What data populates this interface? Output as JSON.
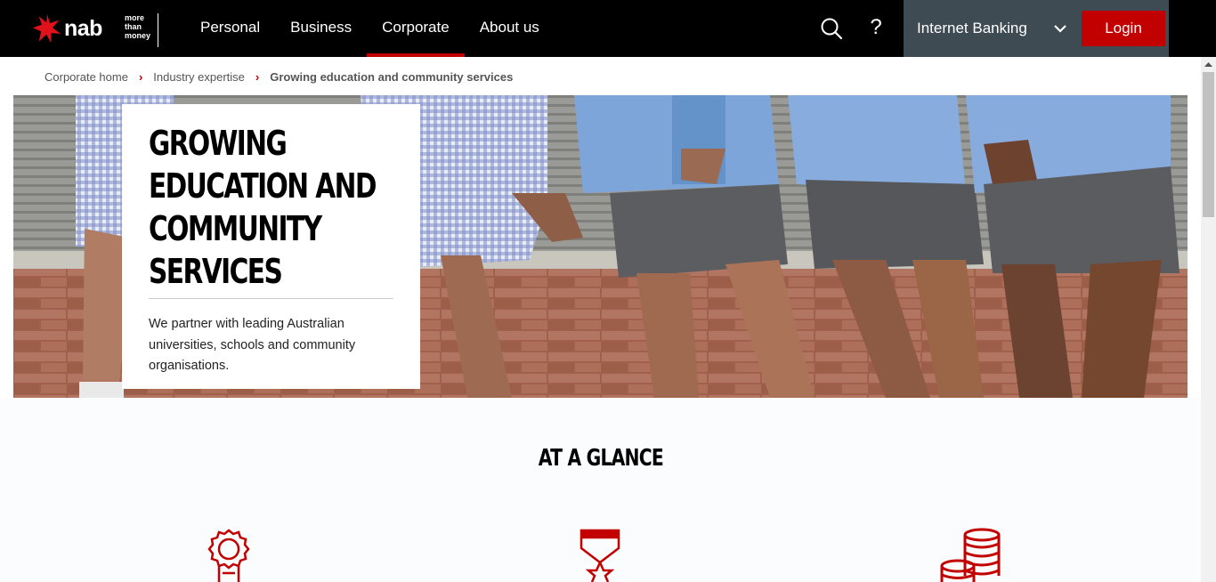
{
  "brand": {
    "logo": "nab",
    "tagline": [
      "more",
      "than",
      "money"
    ],
    "accent_color": "#c20000",
    "star_icon": "nab-star-icon"
  },
  "nav": {
    "items": [
      {
        "label": "Personal"
      },
      {
        "label": "Business"
      },
      {
        "label": "Corporate",
        "active": true
      },
      {
        "label": "About us"
      }
    ],
    "search_icon": "search-icon",
    "help_label": "?",
    "internet_banking_label": "Internet Banking",
    "login_label": "Login"
  },
  "breadcrumb": {
    "items": [
      "Corporate home",
      "Industry expertise",
      "Growing education and community services"
    ],
    "separator": "›"
  },
  "hero": {
    "title": "GROWING EDUCATION AND COMMUNITY SERVICES",
    "description": "We partner with leading Australian universities, schools and community organisations."
  },
  "glance": {
    "title": "AT A GLANCE",
    "icons": [
      "award-ribbon-icon",
      "medal-star-icon",
      "coin-stack-icon"
    ]
  }
}
